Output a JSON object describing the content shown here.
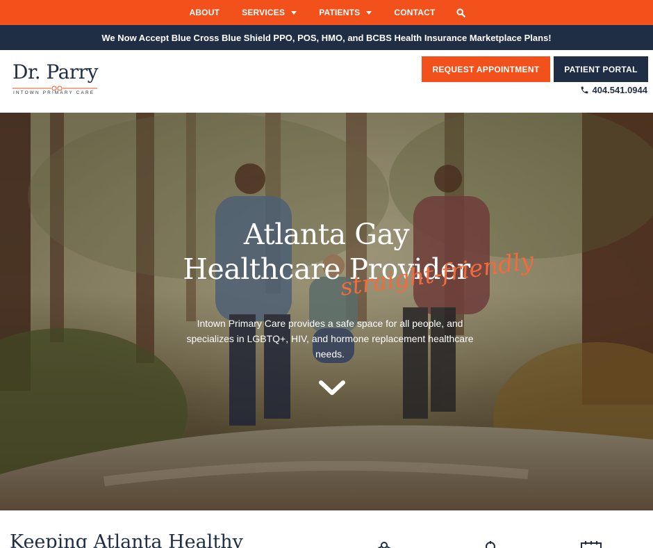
{
  "topnav": {
    "items": [
      {
        "label": "ABOUT",
        "dropdown": false
      },
      {
        "label": "SERVICES",
        "dropdown": true
      },
      {
        "label": "PATIENTS",
        "dropdown": true
      },
      {
        "label": "CONTACT",
        "dropdown": false
      }
    ],
    "search_icon": "search-icon"
  },
  "announcement": {
    "text": "We Now Accept Blue Cross Blue Shield PPO, POS, HMO, and BCBS Health Insurance Marketplace Plans!"
  },
  "header": {
    "logo": {
      "name": "Dr. Parry",
      "tagline": "INTOWN PRIMARY CARE"
    },
    "request_button": "REQUEST APPOINTMENT",
    "portal_button": "PATIENT PORTAL",
    "phone": "404.541.0944"
  },
  "hero": {
    "title_line1": "Atlanta Gay",
    "title_line2": "Healthcare Provider",
    "script": "straight-friendly",
    "subtitle": "Intown Primary Care provides a safe space for all people, and specializes in LGBTQ+, HIV, and hormone replacement healthcare needs."
  },
  "section": {
    "heading": "Keeping Atlanta Healthy"
  },
  "colors": {
    "accent": "#f2511b",
    "navy": "#1f2e45",
    "script": "#f06b3e"
  }
}
